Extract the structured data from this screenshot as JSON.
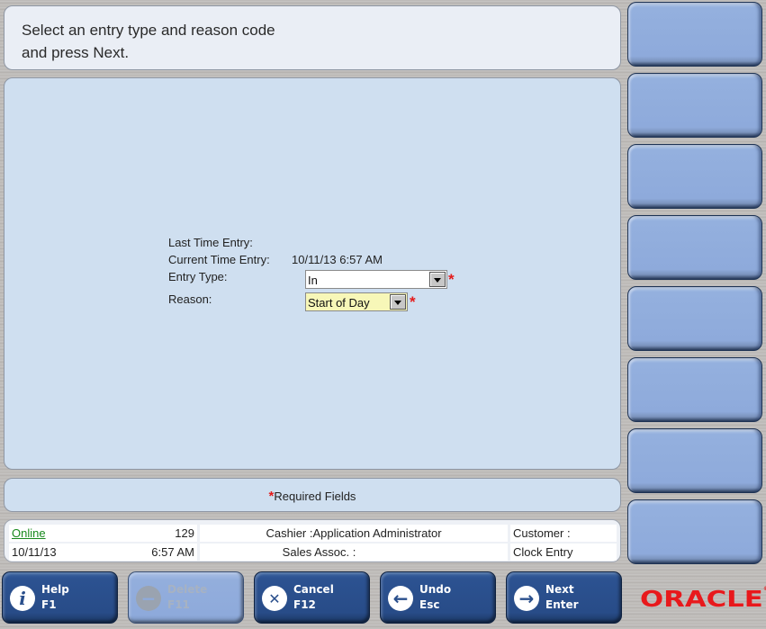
{
  "prompt": {
    "line1": "Select an entry type and reason code",
    "line2": "and press Next."
  },
  "form": {
    "last_time_entry_label": "Last Time Entry:",
    "last_time_entry_value": "",
    "current_time_entry_label": "Current Time Entry:",
    "current_time_entry_value": "10/11/13 6:57 AM",
    "entry_type_label": "Entry Type:",
    "entry_type_value": "In",
    "reason_label": "Reason:",
    "reason_value": "Start of Day",
    "required_marker": "*"
  },
  "required_bar": {
    "marker": "*",
    "text": "Required Fields"
  },
  "status": {
    "online": "Online",
    "register": "129",
    "cashier": "Cashier :Application Administrator",
    "customer": "Customer :",
    "date": "10/11/13",
    "time": "6:57 AM",
    "sales_assoc": "Sales Assoc. :",
    "screen_name": "Clock Entry"
  },
  "side_buttons": [
    "",
    "",
    "",
    "",
    "",
    "",
    "",
    ""
  ],
  "function_buttons": [
    {
      "label": "Help",
      "key": "F1",
      "icon": "info-icon",
      "glyph": "i",
      "enabled": true
    },
    {
      "label": "Delete",
      "key": "F11",
      "icon": "minus-icon",
      "glyph": "−",
      "enabled": false
    },
    {
      "label": "Cancel",
      "key": "F12",
      "icon": "close-icon",
      "glyph": "✕",
      "enabled": true
    },
    {
      "label": "Undo",
      "key": "Esc",
      "icon": "arrow-left-icon",
      "glyph": "←",
      "enabled": true
    },
    {
      "label": "Next",
      "key": "Enter",
      "icon": "arrow-right-icon",
      "glyph": "→",
      "enabled": true
    }
  ],
  "brand": {
    "logo_text": "ORACLE",
    "logo_mark": "®",
    "color": "#e8191c"
  },
  "colors": {
    "button_blue": "#2c5291",
    "side_button": "#8eaadb",
    "work_area": "#cfdff0",
    "required_star": "#e41b1b",
    "reason_field": "#f7f7b8",
    "online_link": "#18891c"
  }
}
